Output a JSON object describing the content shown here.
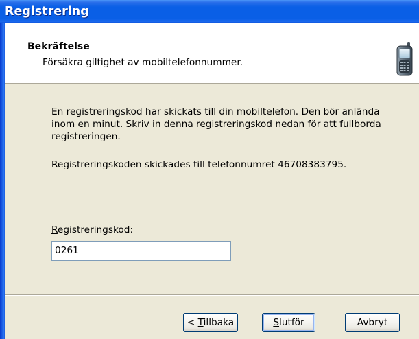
{
  "window": {
    "title": "Registrering"
  },
  "header": {
    "title": "Bekräftelse",
    "subtitle": "Försäkra giltighet av mobiltelefonnummer.",
    "icon": "mobile-phone-icon"
  },
  "body": {
    "message_lines": [
      "En registreringskod har skickats till din mobiltelefon. Den bör anlända",
      "inom en minut. Skriv in denna registreringskod nedan för att fullborda",
      "registreringen."
    ],
    "sent_to": "Registreringskoden skickades till telefonnumret 46708383795."
  },
  "form": {
    "code_label": "Registreringskod:",
    "code_value": "0261"
  },
  "footer": {
    "back_label": "< Tillbaka",
    "finish_label": "Slutför",
    "cancel_label": "Avbryt"
  },
  "theme": {
    "title_bar": "#0A5FE6",
    "frame": "#1757E0",
    "dialog_face": "#ECE9D8",
    "header_background": "#FFFFFF",
    "button_border": "#003C74"
  }
}
